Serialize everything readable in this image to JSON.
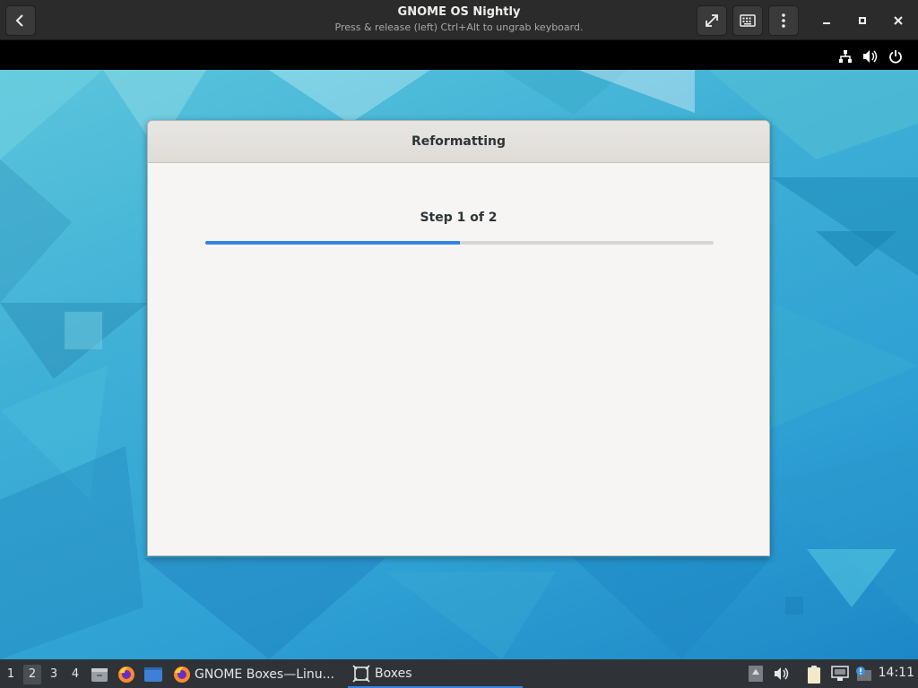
{
  "header": {
    "title": "GNOME OS Nightly",
    "subtitle": "Press & release (left) Ctrl+Alt to ungrab keyboard.",
    "buttons": [
      "back-icon",
      "fullscreen-icon",
      "keyboard-icon",
      "menu-icon",
      "minimize-icon",
      "maximize-icon",
      "close-icon"
    ]
  },
  "guest_topbar": {
    "icons": [
      "network-icon",
      "volume-icon",
      "power-icon"
    ]
  },
  "dialog": {
    "title": "Reformatting",
    "step": "Step 1 of 2",
    "progress": 0.5,
    "accent": "#3584e4"
  },
  "taskbar": {
    "workspaces": [
      "1",
      "2",
      "3",
      "4"
    ],
    "active_workspace": "2",
    "tasks": [
      {
        "label": "GNOME Boxes—Linu...",
        "icon": "firefox-icon",
        "active": false
      },
      {
        "label": "Boxes",
        "icon": "boxes-icon",
        "active": true
      }
    ],
    "clock": "14:11"
  }
}
